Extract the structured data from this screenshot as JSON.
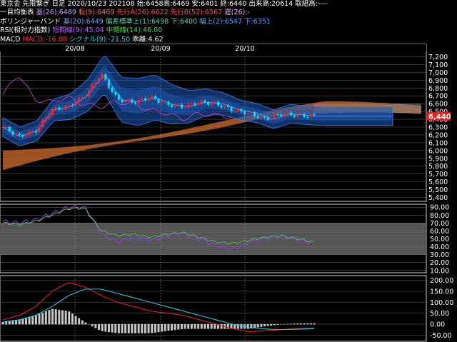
{
  "header": {
    "line1": {
      "symbol": "東京金 先限繋ぎ 日足",
      "date": "2020/10/23",
      "code": "202108",
      "open": "始:6458",
      "high": "高:6469",
      "low": "安:6401",
      "close": "終:6440",
      "volume": "出来高:20614",
      "oi": "取組高:----"
    },
    "line2": {
      "label": "一目均衡表",
      "base": "基(26):6489",
      "conv": "転(9):6469",
      "span_a": "先行A(26):6622",
      "span_b": "先行B(52):6567",
      "lag": "遅(26):-"
    },
    "line3": {
      "label": "ボリンジャーバンド",
      "mid": "基(20):6449",
      "upper1": "偏差標準上(1):6498",
      "lower1": "下:6400",
      "upper2": "幅上(2):6547",
      "lower2": "下:6351"
    },
    "line4": {
      "label": "RSI(相対力指数)",
      "short": "短期線(9):45.04",
      "long": "中期線(14):46.00"
    },
    "line5": {
      "label": "MACD",
      "macd": "MACD:-16.88",
      "signal": "シグナル(9):-21.50",
      "hist": "乖離:4.62"
    }
  },
  "dates": [
    "20/08",
    "20/09",
    "20/10"
  ],
  "price_axis": [
    "7,200",
    "7,100",
    "7,000",
    "6,900",
    "6,800",
    "6,700",
    "6,600",
    "6,500",
    "6,400",
    "6,300",
    "6,200",
    "6,100",
    "6,000",
    "5,900",
    "5,800",
    "5,700",
    "5,600",
    "5,500",
    "5,400"
  ],
  "current_price": "6,440",
  "rsi_axis": [
    "90.00",
    "80.00",
    "70.00",
    "60.00",
    "50.00",
    "40.00",
    "30.00",
    "20.00",
    "10.00"
  ],
  "macd_axis": [
    "200.00",
    "150.00",
    "100.00",
    "50.00",
    "0.00",
    "-50.00"
  ],
  "colors": {
    "up": "#ff2020",
    "down": "#00e0ff",
    "kumo": "#b8602a",
    "bb": "#1e5ab8",
    "rsi_short": "#9040e0",
    "rsi_long": "#50c050",
    "macd": "#e02020",
    "signal": "#30c0d0",
    "hist": "#c8c8c8"
  },
  "chart_data": [
    {
      "type": "line",
      "title": "東京金 先限繋ぎ 日足",
      "ylim": [
        5400,
        7200
      ],
      "x": [
        "20/08",
        "20/09",
        "20/10"
      ],
      "series": [
        {
          "name": "終",
          "values": [
            6300,
            6180,
            6250,
            6520,
            6560,
            6700,
            6980,
            6650,
            6620,
            6680,
            6590,
            6560,
            6620,
            6600,
            6520,
            6480,
            6400,
            6470,
            6450,
            6440
          ]
        }
      ]
    },
    {
      "type": "line",
      "ylim": [
        10,
        90
      ],
      "series": [
        {
          "name": "短期線(9)",
          "values": [
            72,
            70,
            74,
            82,
            90,
            90,
            56,
            46,
            52,
            48,
            54,
            56,
            50,
            42,
            36,
            46,
            50,
            54,
            48,
            45
          ]
        },
        {
          "name": "中期線(14)",
          "values": [
            70,
            68,
            72,
            80,
            88,
            89,
            60,
            54,
            56,
            52,
            56,
            58,
            52,
            46,
            44,
            48,
            52,
            54,
            50,
            46
          ]
        }
      ]
    },
    {
      "type": "line",
      "ylim": [
        -50,
        200
      ],
      "series": [
        {
          "name": "MACD",
          "values": [
            20,
            40,
            80,
            150,
            190,
            170,
            130,
            100,
            80,
            60,
            50,
            40,
            20,
            0,
            -20,
            -35,
            -30,
            -25,
            -20,
            -17
          ]
        },
        {
          "name": "シグナル(9)",
          "values": [
            10,
            20,
            40,
            80,
            130,
            160,
            160,
            140,
            120,
            100,
            80,
            60,
            40,
            20,
            0,
            -15,
            -22,
            -25,
            -23,
            -21
          ]
        }
      ]
    }
  ]
}
